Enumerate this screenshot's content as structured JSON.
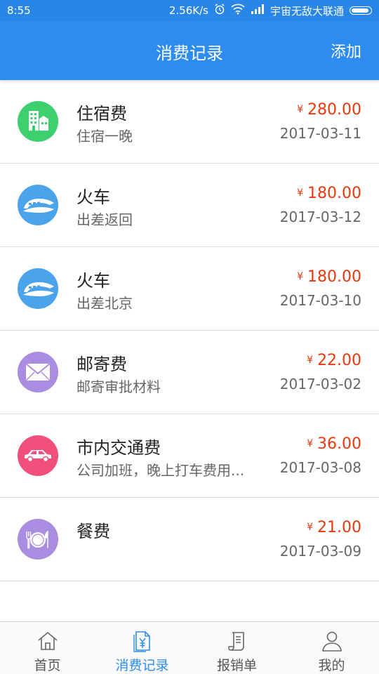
{
  "status_bar": {
    "time": "8:55",
    "speed": "2.56K/s",
    "carrier": "宇宙无敌大联通",
    "icons": [
      "alarm-icon",
      "wifi-icon",
      "signal-icon",
      "battery-icon"
    ]
  },
  "app_bar": {
    "title": "消费记录",
    "add_label": "添加",
    "color": "#2d8cf0"
  },
  "records": [
    {
      "name": "住宿费",
      "note": "住宿一晚",
      "currency": "¥",
      "amount": "280.00",
      "date": "2017-03-11",
      "icon": "hotel-icon",
      "icon_color": "#3ecf6e"
    },
    {
      "name": "火车",
      "note": "出差返回",
      "currency": "¥",
      "amount": "180.00",
      "date": "2017-03-12",
      "icon": "train-icon",
      "icon_color": "#4ba3ec"
    },
    {
      "name": "火车",
      "note": "出差北京",
      "currency": "¥",
      "amount": "180.00",
      "date": "2017-03-10",
      "icon": "train-icon",
      "icon_color": "#4ba3ec"
    },
    {
      "name": "邮寄费",
      "note": "邮寄审批材料",
      "currency": "¥",
      "amount": "22.00",
      "date": "2017-03-02",
      "icon": "mail-icon",
      "icon_color": "#a98de0"
    },
    {
      "name": "市内交通费",
      "note": "公司加班，晚上打车费用...",
      "currency": "¥",
      "amount": "36.00",
      "date": "2017-03-08",
      "icon": "car-icon",
      "icon_color": "#f0507a"
    },
    {
      "name": "餐费",
      "note": "",
      "currency": "¥",
      "amount": "21.00",
      "date": "2017-03-09",
      "icon": "dining-icon",
      "icon_color": "#a98de0"
    }
  ],
  "tabs": [
    {
      "label": "首页",
      "icon": "home-icon"
    },
    {
      "label": "消费记录",
      "icon": "expense-record-icon",
      "active": true
    },
    {
      "label": "报销单",
      "icon": "reimbursement-icon"
    },
    {
      "label": "我的",
      "icon": "profile-icon"
    }
  ],
  "colors": {
    "amount": "#e8380d",
    "active_tab": "#2d8cf0"
  }
}
